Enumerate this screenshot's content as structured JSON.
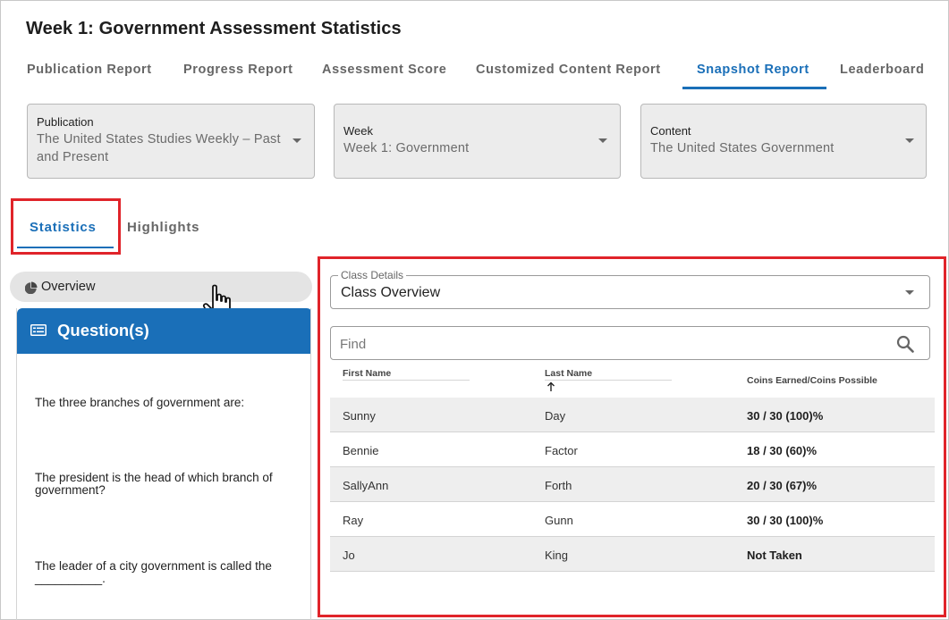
{
  "page": {
    "title": "Week 1: Government Assessment Statistics"
  },
  "report_tabs": [
    {
      "label": "Publication Report"
    },
    {
      "label": "Progress Report"
    },
    {
      "label": "Assessment Score"
    },
    {
      "label": "Customized Content Report"
    },
    {
      "label": "Snapshot Report",
      "active": true
    },
    {
      "label": "Leaderboard"
    }
  ],
  "filters": {
    "publication": {
      "label": "Publication",
      "value_line1": "The United States Studies Weekly – Past",
      "value_line2": "and Present"
    },
    "week": {
      "label": "Week",
      "value": "Week 1: Government"
    },
    "content": {
      "label": "Content",
      "value": "The United States Government"
    }
  },
  "sub_tabs": [
    {
      "label": "Statistics",
      "active": true
    },
    {
      "label": "Highlights"
    }
  ],
  "overview": {
    "label": "Overview",
    "icon": "pie-chart-icon"
  },
  "questions": {
    "header": "Question(s)",
    "icon": "document-list-icon",
    "items": [
      {
        "line1": "The three branches of government are:"
      },
      {
        "line1": "The president is the head of which branch of",
        "line2": "government?"
      },
      {
        "line1": "The leader of a city government is called the",
        "line2": "__________."
      }
    ]
  },
  "class_details": {
    "legend": "Class Details",
    "value": "Class Overview"
  },
  "search": {
    "placeholder": "Find",
    "icon": "search-icon"
  },
  "table": {
    "columns": [
      "First Name",
      "Last Name",
      "Coins Earned/Coins Possible"
    ],
    "sort": {
      "column": "Last Name",
      "direction": "ascending",
      "indicator": "↑"
    },
    "rows": [
      {
        "first": "Sunny",
        "last": "Day",
        "coins": "30 / 30 (100)%"
      },
      {
        "first": "Bennie",
        "last": "Factor",
        "coins": "18 / 30 (60)%"
      },
      {
        "first": "SallyAnn",
        "last": "Forth",
        "coins": "20 / 30 (67)%"
      },
      {
        "first": "Ray",
        "last": "Gunn",
        "coins": "30 / 30 (100)%"
      },
      {
        "first": "Jo",
        "last": "King",
        "coins": "Not Taken"
      }
    ]
  },
  "colors": {
    "accent": "#1a6fb8",
    "highlight": "#e0242a",
    "header_bg": "#1a6fb8"
  }
}
